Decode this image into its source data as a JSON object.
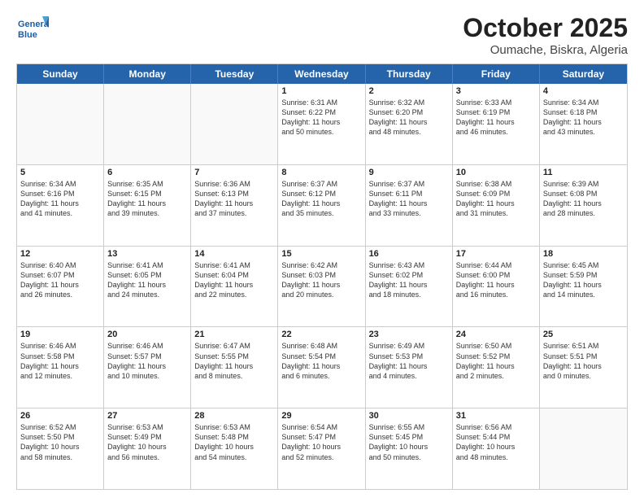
{
  "header": {
    "logo_general": "General",
    "logo_blue": "Blue",
    "title": "October 2025",
    "subtitle": "Oumache, Biskra, Algeria"
  },
  "days": [
    "Sunday",
    "Monday",
    "Tuesday",
    "Wednesday",
    "Thursday",
    "Friday",
    "Saturday"
  ],
  "rows": [
    [
      {
        "day": "",
        "empty": true
      },
      {
        "day": "",
        "empty": true
      },
      {
        "day": "",
        "empty": true
      },
      {
        "day": "1",
        "lines": [
          "Sunrise: 6:31 AM",
          "Sunset: 6:22 PM",
          "Daylight: 11 hours",
          "and 50 minutes."
        ]
      },
      {
        "day": "2",
        "lines": [
          "Sunrise: 6:32 AM",
          "Sunset: 6:20 PM",
          "Daylight: 11 hours",
          "and 48 minutes."
        ]
      },
      {
        "day": "3",
        "lines": [
          "Sunrise: 6:33 AM",
          "Sunset: 6:19 PM",
          "Daylight: 11 hours",
          "and 46 minutes."
        ]
      },
      {
        "day": "4",
        "lines": [
          "Sunrise: 6:34 AM",
          "Sunset: 6:18 PM",
          "Daylight: 11 hours",
          "and 43 minutes."
        ]
      }
    ],
    [
      {
        "day": "5",
        "lines": [
          "Sunrise: 6:34 AM",
          "Sunset: 6:16 PM",
          "Daylight: 11 hours",
          "and 41 minutes."
        ]
      },
      {
        "day": "6",
        "lines": [
          "Sunrise: 6:35 AM",
          "Sunset: 6:15 PM",
          "Daylight: 11 hours",
          "and 39 minutes."
        ]
      },
      {
        "day": "7",
        "lines": [
          "Sunrise: 6:36 AM",
          "Sunset: 6:13 PM",
          "Daylight: 11 hours",
          "and 37 minutes."
        ]
      },
      {
        "day": "8",
        "lines": [
          "Sunrise: 6:37 AM",
          "Sunset: 6:12 PM",
          "Daylight: 11 hours",
          "and 35 minutes."
        ]
      },
      {
        "day": "9",
        "lines": [
          "Sunrise: 6:37 AM",
          "Sunset: 6:11 PM",
          "Daylight: 11 hours",
          "and 33 minutes."
        ]
      },
      {
        "day": "10",
        "lines": [
          "Sunrise: 6:38 AM",
          "Sunset: 6:09 PM",
          "Daylight: 11 hours",
          "and 31 minutes."
        ]
      },
      {
        "day": "11",
        "lines": [
          "Sunrise: 6:39 AM",
          "Sunset: 6:08 PM",
          "Daylight: 11 hours",
          "and 28 minutes."
        ]
      }
    ],
    [
      {
        "day": "12",
        "lines": [
          "Sunrise: 6:40 AM",
          "Sunset: 6:07 PM",
          "Daylight: 11 hours",
          "and 26 minutes."
        ]
      },
      {
        "day": "13",
        "lines": [
          "Sunrise: 6:41 AM",
          "Sunset: 6:05 PM",
          "Daylight: 11 hours",
          "and 24 minutes."
        ]
      },
      {
        "day": "14",
        "lines": [
          "Sunrise: 6:41 AM",
          "Sunset: 6:04 PM",
          "Daylight: 11 hours",
          "and 22 minutes."
        ]
      },
      {
        "day": "15",
        "lines": [
          "Sunrise: 6:42 AM",
          "Sunset: 6:03 PM",
          "Daylight: 11 hours",
          "and 20 minutes."
        ]
      },
      {
        "day": "16",
        "lines": [
          "Sunrise: 6:43 AM",
          "Sunset: 6:02 PM",
          "Daylight: 11 hours",
          "and 18 minutes."
        ]
      },
      {
        "day": "17",
        "lines": [
          "Sunrise: 6:44 AM",
          "Sunset: 6:00 PM",
          "Daylight: 11 hours",
          "and 16 minutes."
        ]
      },
      {
        "day": "18",
        "lines": [
          "Sunrise: 6:45 AM",
          "Sunset: 5:59 PM",
          "Daylight: 11 hours",
          "and 14 minutes."
        ]
      }
    ],
    [
      {
        "day": "19",
        "lines": [
          "Sunrise: 6:46 AM",
          "Sunset: 5:58 PM",
          "Daylight: 11 hours",
          "and 12 minutes."
        ]
      },
      {
        "day": "20",
        "lines": [
          "Sunrise: 6:46 AM",
          "Sunset: 5:57 PM",
          "Daylight: 11 hours",
          "and 10 minutes."
        ]
      },
      {
        "day": "21",
        "lines": [
          "Sunrise: 6:47 AM",
          "Sunset: 5:55 PM",
          "Daylight: 11 hours",
          "and 8 minutes."
        ]
      },
      {
        "day": "22",
        "lines": [
          "Sunrise: 6:48 AM",
          "Sunset: 5:54 PM",
          "Daylight: 11 hours",
          "and 6 minutes."
        ]
      },
      {
        "day": "23",
        "lines": [
          "Sunrise: 6:49 AM",
          "Sunset: 5:53 PM",
          "Daylight: 11 hours",
          "and 4 minutes."
        ]
      },
      {
        "day": "24",
        "lines": [
          "Sunrise: 6:50 AM",
          "Sunset: 5:52 PM",
          "Daylight: 11 hours",
          "and 2 minutes."
        ]
      },
      {
        "day": "25",
        "lines": [
          "Sunrise: 6:51 AM",
          "Sunset: 5:51 PM",
          "Daylight: 11 hours",
          "and 0 minutes."
        ]
      }
    ],
    [
      {
        "day": "26",
        "lines": [
          "Sunrise: 6:52 AM",
          "Sunset: 5:50 PM",
          "Daylight: 10 hours",
          "and 58 minutes."
        ]
      },
      {
        "day": "27",
        "lines": [
          "Sunrise: 6:53 AM",
          "Sunset: 5:49 PM",
          "Daylight: 10 hours",
          "and 56 minutes."
        ]
      },
      {
        "day": "28",
        "lines": [
          "Sunrise: 6:53 AM",
          "Sunset: 5:48 PM",
          "Daylight: 10 hours",
          "and 54 minutes."
        ]
      },
      {
        "day": "29",
        "lines": [
          "Sunrise: 6:54 AM",
          "Sunset: 5:47 PM",
          "Daylight: 10 hours",
          "and 52 minutes."
        ]
      },
      {
        "day": "30",
        "lines": [
          "Sunrise: 6:55 AM",
          "Sunset: 5:45 PM",
          "Daylight: 10 hours",
          "and 50 minutes."
        ]
      },
      {
        "day": "31",
        "lines": [
          "Sunrise: 6:56 AM",
          "Sunset: 5:44 PM",
          "Daylight: 10 hours",
          "and 48 minutes."
        ]
      },
      {
        "day": "",
        "empty": true
      }
    ]
  ]
}
